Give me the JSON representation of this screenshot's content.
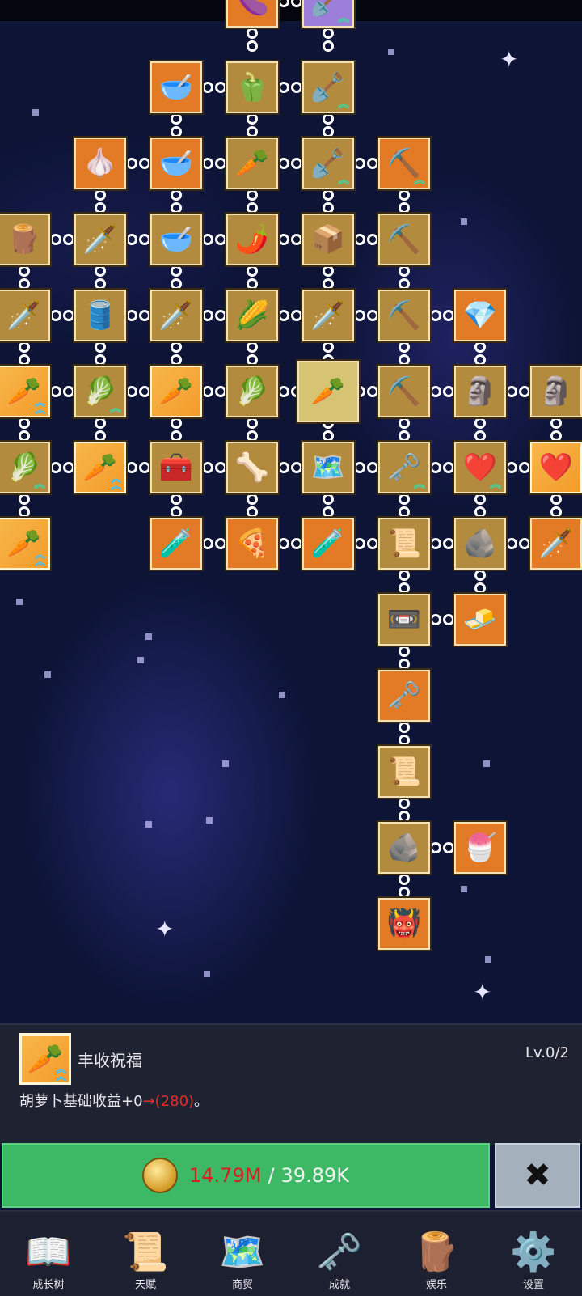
{
  "tree": {
    "nodes": [
      {
        "col": 3,
        "row": 0,
        "icon": "🍆",
        "bg": "orange"
      },
      {
        "col": 4,
        "row": 0,
        "icon": "🪏",
        "bg": "purple",
        "badge": "up"
      },
      {
        "col": 2,
        "row": 1,
        "icon": "🥣",
        "bg": "orange"
      },
      {
        "col": 3,
        "row": 1,
        "icon": "🫑",
        "bg": "tan"
      },
      {
        "col": 4,
        "row": 1,
        "icon": "🪏",
        "bg": "tan",
        "badge": "up"
      },
      {
        "col": 1,
        "row": 2,
        "icon": "🧄",
        "bg": "orange"
      },
      {
        "col": 2,
        "row": 2,
        "icon": "🥣",
        "bg": "orange"
      },
      {
        "col": 3,
        "row": 2,
        "icon": "🥕",
        "bg": "tan"
      },
      {
        "col": 4,
        "row": 2,
        "icon": "🪏",
        "bg": "tan",
        "badge": "up"
      },
      {
        "col": 5,
        "row": 2,
        "icon": "⛏️",
        "bg": "orange",
        "badge": "up"
      },
      {
        "col": 0,
        "row": 3,
        "icon": "🪵",
        "bg": "tan"
      },
      {
        "col": 1,
        "row": 3,
        "icon": "🗡️",
        "bg": "tan"
      },
      {
        "col": 2,
        "row": 3,
        "icon": "🥣",
        "bg": "tan"
      },
      {
        "col": 3,
        "row": 3,
        "icon": "🌶️",
        "bg": "tan"
      },
      {
        "col": 4,
        "row": 3,
        "icon": "📦",
        "bg": "tan"
      },
      {
        "col": 5,
        "row": 3,
        "icon": "⛏️",
        "bg": "tan"
      },
      {
        "col": 0,
        "row": 4,
        "icon": "🗡️",
        "bg": "tan"
      },
      {
        "col": 1,
        "row": 4,
        "icon": "🛢️",
        "bg": "tan"
      },
      {
        "col": 2,
        "row": 4,
        "icon": "🗡️",
        "bg": "tan"
      },
      {
        "col": 3,
        "row": 4,
        "icon": "🌽",
        "bg": "tan"
      },
      {
        "col": 4,
        "row": 4,
        "icon": "🗡️",
        "bg": "tan"
      },
      {
        "col": 5,
        "row": 4,
        "icon": "⛏️",
        "bg": "tan"
      },
      {
        "col": 6,
        "row": 4,
        "icon": "💎",
        "bg": "orange"
      },
      {
        "col": 0,
        "row": 5,
        "icon": "🥕",
        "bg": "special",
        "badge": "up2"
      },
      {
        "col": 1,
        "row": 5,
        "icon": "🥬",
        "bg": "tan",
        "badge": "up"
      },
      {
        "col": 2,
        "row": 5,
        "icon": "🥕",
        "bg": "special"
      },
      {
        "col": 3,
        "row": 5,
        "icon": "🥬",
        "bg": "tan"
      },
      {
        "col": 4,
        "row": 5,
        "icon": "🥕",
        "bg": "selected"
      },
      {
        "col": 5,
        "row": 5,
        "icon": "⛏️",
        "bg": "tan"
      },
      {
        "col": 6,
        "row": 5,
        "icon": "🗿",
        "bg": "tan"
      },
      {
        "col": 7,
        "row": 5,
        "icon": "🗿",
        "bg": "tan"
      },
      {
        "col": 0,
        "row": 6,
        "icon": "🥬",
        "bg": "tan",
        "badge": "up"
      },
      {
        "col": 1,
        "row": 6,
        "icon": "🥕",
        "bg": "special",
        "badge": "up2"
      },
      {
        "col": 2,
        "row": 6,
        "icon": "🧰",
        "bg": "tan"
      },
      {
        "col": 3,
        "row": 6,
        "icon": "🦴",
        "bg": "tan"
      },
      {
        "col": 4,
        "row": 6,
        "icon": "🗺️",
        "bg": "tan"
      },
      {
        "col": 5,
        "row": 6,
        "icon": "🗝️",
        "bg": "tan",
        "badge": "up"
      },
      {
        "col": 6,
        "row": 6,
        "icon": "❤️",
        "bg": "tan",
        "badge": "up"
      },
      {
        "col": 7,
        "row": 6,
        "icon": "❤️",
        "bg": "special"
      },
      {
        "col": 0,
        "row": 7,
        "icon": "🥕",
        "bg": "special",
        "badge": "up2"
      },
      {
        "col": 2,
        "row": 7,
        "icon": "🧪",
        "bg": "orange"
      },
      {
        "col": 3,
        "row": 7,
        "icon": "🍕",
        "bg": "orange"
      },
      {
        "col": 4,
        "row": 7,
        "icon": "🧪",
        "bg": "orange"
      },
      {
        "col": 5,
        "row": 7,
        "icon": "📜",
        "bg": "tan"
      },
      {
        "col": 6,
        "row": 7,
        "icon": "🪨",
        "bg": "tan"
      },
      {
        "col": 7,
        "row": 7,
        "icon": "🗡️",
        "bg": "orange"
      },
      {
        "col": 5,
        "row": 8,
        "icon": "📼",
        "bg": "tan"
      },
      {
        "col": 6,
        "row": 8,
        "icon": "🧈",
        "bg": "orange"
      },
      {
        "col": 5,
        "row": 9,
        "icon": "🗝️",
        "bg": "orange"
      },
      {
        "col": 5,
        "row": 10,
        "icon": "📜",
        "bg": "tan"
      },
      {
        "col": 5,
        "row": 11,
        "icon": "🪨",
        "bg": "tan"
      },
      {
        "col": 6,
        "row": 11,
        "icon": "🍧",
        "bg": "orange"
      },
      {
        "col": 5,
        "row": 12,
        "icon": "👹",
        "bg": "orange"
      }
    ]
  },
  "info": {
    "icon": "🥕",
    "title": "丰收祝福",
    "level": "Lv.0/2",
    "desc_prefix": "胡萝卜基础收益+0",
    "desc_arrow": "→",
    "desc_value": "(280)",
    "desc_suffix": "。"
  },
  "purchase": {
    "current": "14.79M",
    "separator": "/",
    "cost": "39.89K",
    "close_icon": "✖"
  },
  "nav": [
    {
      "label": "成长树",
      "icon": "📖"
    },
    {
      "label": "天赋",
      "icon": "📜"
    },
    {
      "label": "商贸",
      "icon": "🗺️"
    },
    {
      "label": "成就",
      "icon": "🗝️"
    },
    {
      "label": "娱乐",
      "icon": "🪵"
    },
    {
      "label": "设置",
      "icon": "⚙️"
    }
  ],
  "colors": {
    "orange": "#e27a26",
    "tan": "#b28b3e",
    "purple": "#9b7fd8",
    "buy_green": "#3db966",
    "red_text": "#d62020"
  }
}
